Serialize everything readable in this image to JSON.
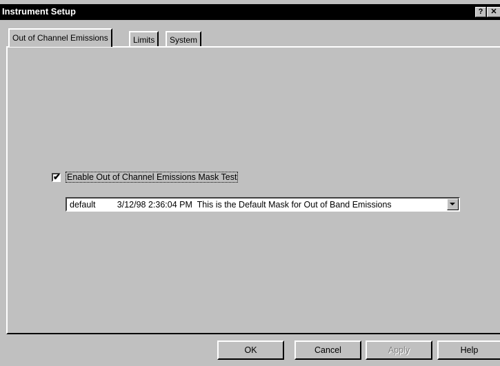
{
  "window": {
    "title": "Instrument Setup",
    "help_glyph": "?",
    "close_glyph": "✕"
  },
  "tabs": [
    {
      "label": "Out of Channel Emissions",
      "selected": true
    },
    {
      "label": "Limits",
      "selected": false
    },
    {
      "label": "System",
      "selected": false
    }
  ],
  "mask_test": {
    "enabled": true,
    "label": "Enable Out of Channel Emissions Mask Test"
  },
  "mask_select": {
    "value": "default         3/12/98 2:36:04 PM  This is the Default Mask for Out of Band Emissions"
  },
  "buttons": {
    "ok": "OK",
    "cancel": "Cancel",
    "apply": "Apply",
    "help": "Help"
  }
}
